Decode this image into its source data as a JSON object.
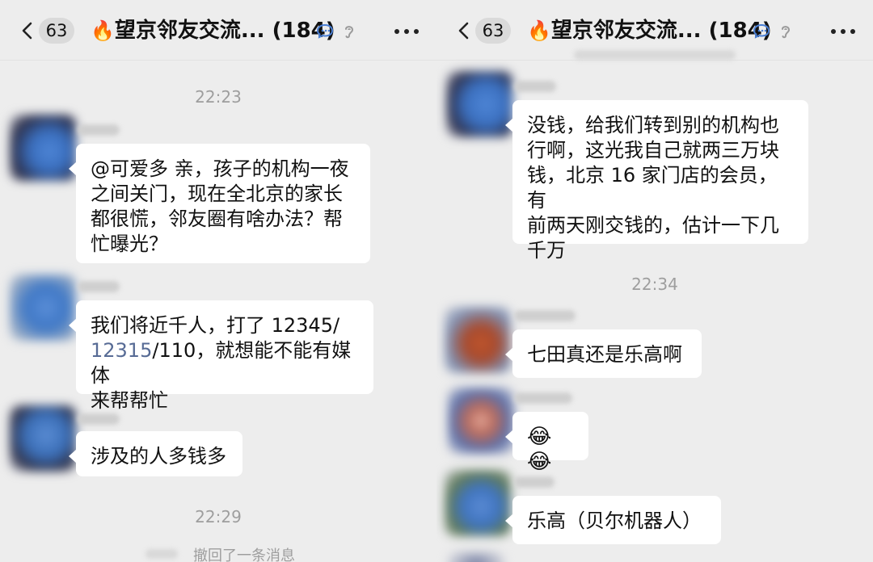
{
  "left": {
    "header": {
      "back_count": "63",
      "fire": "🔥",
      "title": "望京邻友交流...",
      "member_count": "(184)"
    },
    "time_1": "22:23",
    "messages": [
      {
        "text": "@可爱多 亲，孩子的机构一夜\n之间关门，现在全北京的家长\n都很慌，邻友圈有啥办法？帮\n忙曝光？"
      },
      {
        "text_a": "我们将近千人，打了 12345/\n",
        "link": "12315",
        "text_b": "/110，就想能不能有媒体\n来帮帮忙"
      },
      {
        "text": "涉及的人多钱多"
      }
    ],
    "time_2": "22:29",
    "recall_notice": "撤回了一条消息"
  },
  "right": {
    "header": {
      "back_count": "63",
      "fire": "🔥",
      "title": "望京邻友交流...",
      "member_count": "(184)"
    },
    "messages_top": [
      {
        "text": "没钱，给我们转到别的机构也\n行啊，这光我自己就两三万块\n钱，北京 16 家门店的会员，有\n前两天刚交钱的，估计一下几\n千万"
      }
    ],
    "time_1": "22:34",
    "messages_bottom": [
      {
        "text": "七田真还是乐高啊"
      },
      {
        "text": "😂😂"
      },
      {
        "text": "乐高（贝尔机器人）"
      }
    ]
  },
  "colors": {
    "background": "#ededed",
    "bubble": "#ffffff",
    "link": "#576b95",
    "time": "#9e9e9e"
  },
  "icons": [
    "back-chevron-icon",
    "fire-icon",
    "chat-bubble-icon",
    "ear-mute-icon",
    "more-dots-icon"
  ]
}
